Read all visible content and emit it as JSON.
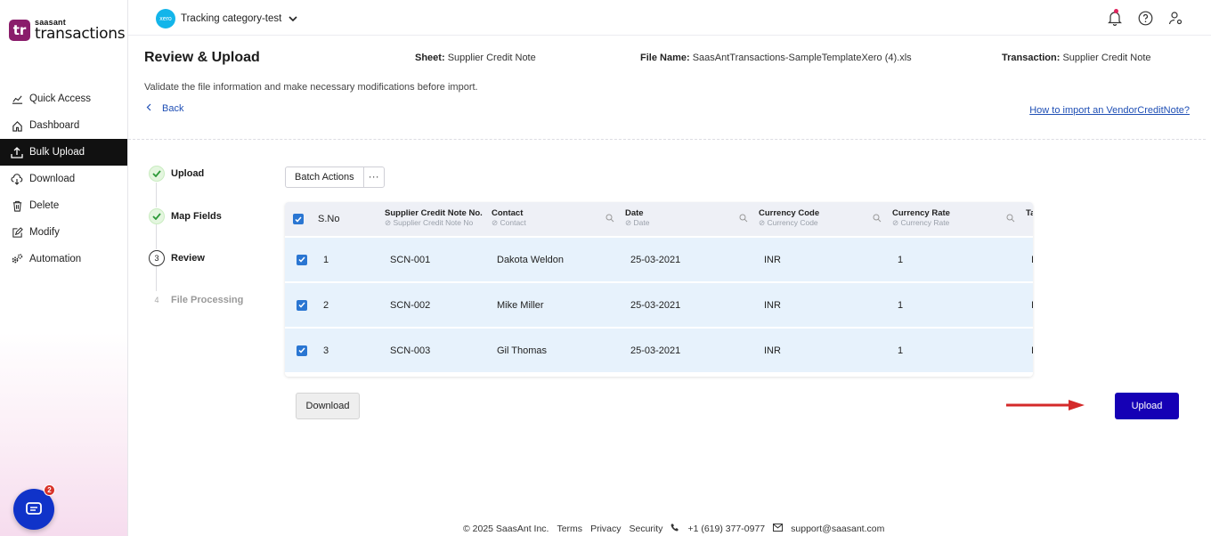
{
  "app": {
    "brand": "saasant",
    "product": "transactions",
    "logo_mark": "tr"
  },
  "sidebar": {
    "items": [
      {
        "label": "Quick Access",
        "icon": "chart-line-icon"
      },
      {
        "label": "Dashboard",
        "icon": "home-icon"
      },
      {
        "label": "Bulk Upload",
        "icon": "upload-icon",
        "active": true
      },
      {
        "label": "Download",
        "icon": "cloud-download-icon"
      },
      {
        "label": "Delete",
        "icon": "trash-icon"
      },
      {
        "label": "Modify",
        "icon": "edit-icon"
      },
      {
        "label": "Automation",
        "icon": "gears-icon"
      }
    ],
    "chat_badge": "2"
  },
  "topbar": {
    "xero_label": "xero",
    "org_name": "Tracking category-test"
  },
  "header": {
    "title": "Review & Upload",
    "sheet_label": "Sheet:",
    "sheet_value": "Supplier Credit Note",
    "file_label": "File Name:",
    "file_value": "SaasAntTransactions-SampleTemplateXero (4).xls",
    "transaction_label": "Transaction:",
    "transaction_value": "Supplier Credit Note",
    "subtitle": "Validate the file information and make necessary modifications before import.",
    "back_label": "Back",
    "help_link": "How to import an VendorCreditNote?"
  },
  "steps": [
    {
      "label": "Upload",
      "state": "done",
      "num": "1"
    },
    {
      "label": "Map Fields",
      "state": "done",
      "num": "2"
    },
    {
      "label": "Review",
      "state": "current",
      "num": "3"
    },
    {
      "label": "File Processing",
      "state": "pending",
      "num": "4"
    }
  ],
  "table": {
    "batch_label": "Batch Actions",
    "more_label": "···",
    "columns": [
      {
        "title": "S.No",
        "sub": ""
      },
      {
        "title": "Supplier Credit Note No.",
        "sub": "Supplier Credit Note No"
      },
      {
        "title": "Contact",
        "sub": "Contact"
      },
      {
        "title": "Date",
        "sub": "Date"
      },
      {
        "title": "Currency Code",
        "sub": "Currency Code"
      },
      {
        "title": "Currency Rate",
        "sub": "Currency Rate"
      },
      {
        "title": "Ta",
        "sub": ""
      }
    ],
    "rows": [
      {
        "sno": "1",
        "note": "SCN-001",
        "contact": "Dakota Weldon",
        "date": "25-03-2021",
        "code": "INR",
        "rate": "1",
        "extra": "I"
      },
      {
        "sno": "2",
        "note": "SCN-002",
        "contact": "Mike Miller",
        "date": "25-03-2021",
        "code": "INR",
        "rate": "1",
        "extra": "I"
      },
      {
        "sno": "3",
        "note": "SCN-003",
        "contact": "Gil Thomas",
        "date": "25-03-2021",
        "code": "INR",
        "rate": "1",
        "extra": "I"
      }
    ]
  },
  "actions": {
    "download": "Download",
    "upload": "Upload",
    "upload_color": "#1500b5"
  },
  "footer": {
    "copyright": "© 2025 SaasAnt Inc.",
    "terms": "Terms",
    "privacy": "Privacy",
    "security": "Security",
    "phone": "+1 (619) 377-0977",
    "email": "support@saasant.com"
  }
}
